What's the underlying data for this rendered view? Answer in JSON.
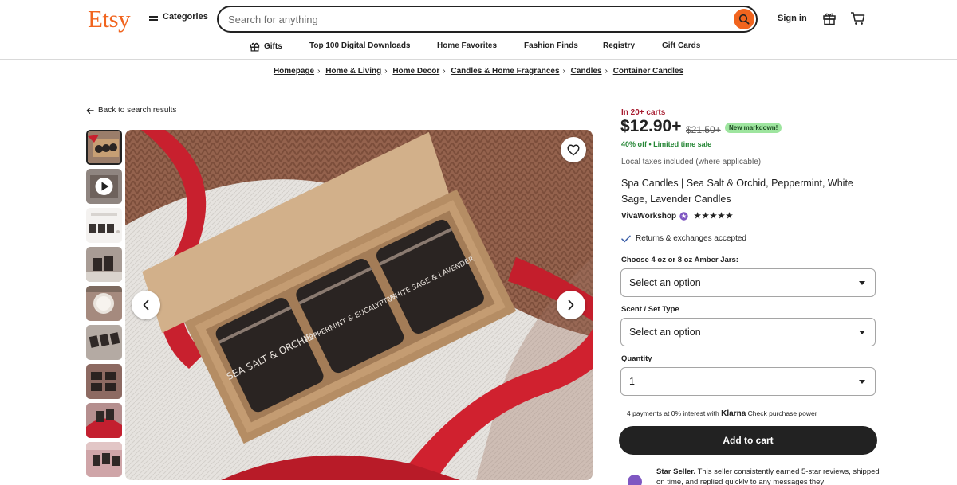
{
  "header": {
    "logo": "Etsy",
    "categories_label": "Categories",
    "search_placeholder": "Search for anything",
    "signin_label": "Sign in"
  },
  "nav": {
    "items": [
      "Gifts",
      "Top 100 Digital Downloads",
      "Home Favorites",
      "Fashion Finds",
      "Registry",
      "Gift Cards"
    ]
  },
  "breadcrumb": [
    "Homepage",
    "Home & Living",
    "Home Decor",
    "Candles & Home Fragrances",
    "Candles",
    "Container Candles"
  ],
  "back_label": "Back to search results",
  "gallery": {
    "thumb_count": 9,
    "candles": [
      "SEA SALT & ORCHID",
      "PEPPERMINT & EUCALYPTUS",
      "WHITE SAGE & LAVENDER"
    ]
  },
  "product": {
    "in_carts": "In 20+ carts",
    "price": "$12.90+",
    "old_price": "$21.50+",
    "markdown_badge": "New markdown!",
    "sale_text": "40% off  •  Limited time sale",
    "taxes": "Local taxes included (where applicable)",
    "title": "Spa Candles | Sea Salt & Orchid, Peppermint, White Sage, Lavender Candles",
    "shop_name": "VivaWorkshop",
    "stars": "★★★★★",
    "returns": "Returns & exchanges accepted",
    "option1_label": "Choose 4 oz or 8 oz Amber Jars:",
    "option1_value": "Select an option",
    "option2_label": "Scent / Set Type",
    "option2_value": "Select an option",
    "quantity_label": "Quantity",
    "quantity_value": "1",
    "klarna_prefix": "4 payments at 0% interest with",
    "klarna_brand": "Klarna",
    "klarna_link": "Check purchase power",
    "add_to_cart": "Add to cart",
    "star_seller_title": "Star Seller.",
    "star_seller_text": "This seller consistently earned 5-star reviews, shipped on time, and replied quickly to any messages they"
  },
  "colors": {
    "brand": "#f1641e",
    "primary_button": "#222222",
    "sale_green": "#258635",
    "carts_red": "#a61a2e",
    "markdown_bg": "#9ee59f",
    "star_seller": "#7f57c2"
  }
}
